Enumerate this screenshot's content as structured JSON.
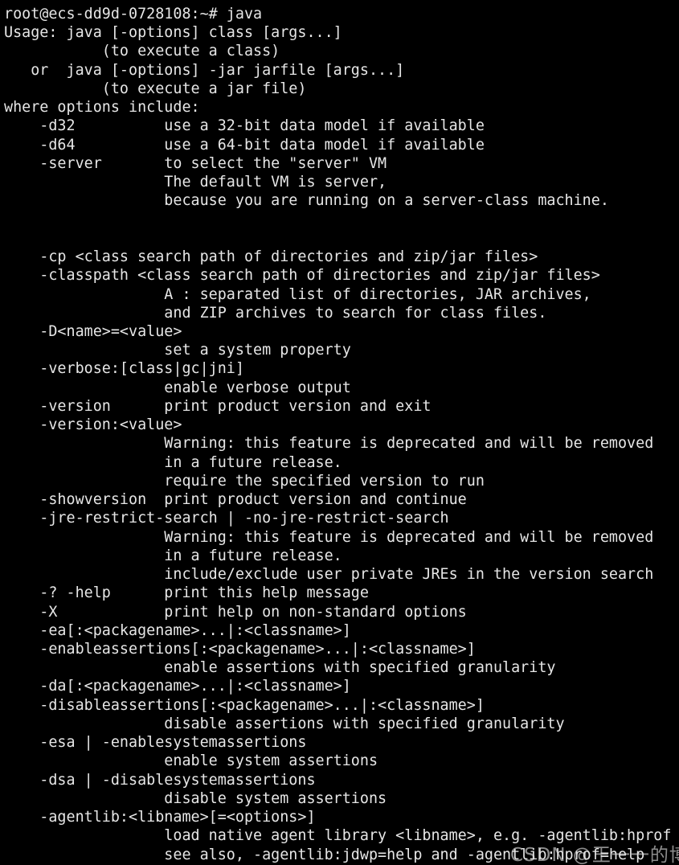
{
  "terminal": {
    "background_color": "#000000",
    "text_color": "#e6e6e6",
    "prompt": "root@ecs-dd9d-0728108:~# ",
    "command": "java",
    "lines": [
      "root@ecs-dd9d-0728108:~# java",
      "Usage: java [-options] class [args...]",
      "           (to execute a class)",
      "   or  java [-options] -jar jarfile [args...]",
      "           (to execute a jar file)",
      "where options include:",
      "    -d32          use a 32-bit data model if available",
      "    -d64          use a 64-bit data model if available",
      "    -server       to select the \"server\" VM",
      "                  The default VM is server,",
      "                  because you are running on a server-class machine.",
      "",
      "",
      "    -cp <class search path of directories and zip/jar files>",
      "    -classpath <class search path of directories and zip/jar files>",
      "                  A : separated list of directories, JAR archives,",
      "                  and ZIP archives to search for class files.",
      "    -D<name>=<value>",
      "                  set a system property",
      "    -verbose:[class|gc|jni]",
      "                  enable verbose output",
      "    -version      print product version and exit",
      "    -version:<value>",
      "                  Warning: this feature is deprecated and will be removed",
      "                  in a future release.",
      "                  require the specified version to run",
      "    -showversion  print product version and continue",
      "    -jre-restrict-search | -no-jre-restrict-search",
      "                  Warning: this feature is deprecated and will be removed",
      "                  in a future release.",
      "                  include/exclude user private JREs in the version search",
      "    -? -help      print this help message",
      "    -X            print help on non-standard options",
      "    -ea[:<packagename>...|:<classname>]",
      "    -enableassertions[:<packagename>...|:<classname>]",
      "                  enable assertions with specified granularity",
      "    -da[:<packagename>...|:<classname>]",
      "    -disableassertions[:<packagename>...|:<classname>]",
      "                  disable assertions with specified granularity",
      "    -esa | -enablesystemassertions",
      "                  enable system assertions",
      "    -dsa | -disablesystemassertions",
      "                  disable system assertions",
      "    -agentlib:<libname>[=<options>]",
      "                  load native agent library <libname>, e.g. -agentlib:hprof",
      "                  see also, -agentlib:jdwp=help and -agentlib:hprof=help"
    ]
  },
  "watermark": {
    "text": "CSDN @王一一的博客",
    "color": "#e1e1e1"
  }
}
